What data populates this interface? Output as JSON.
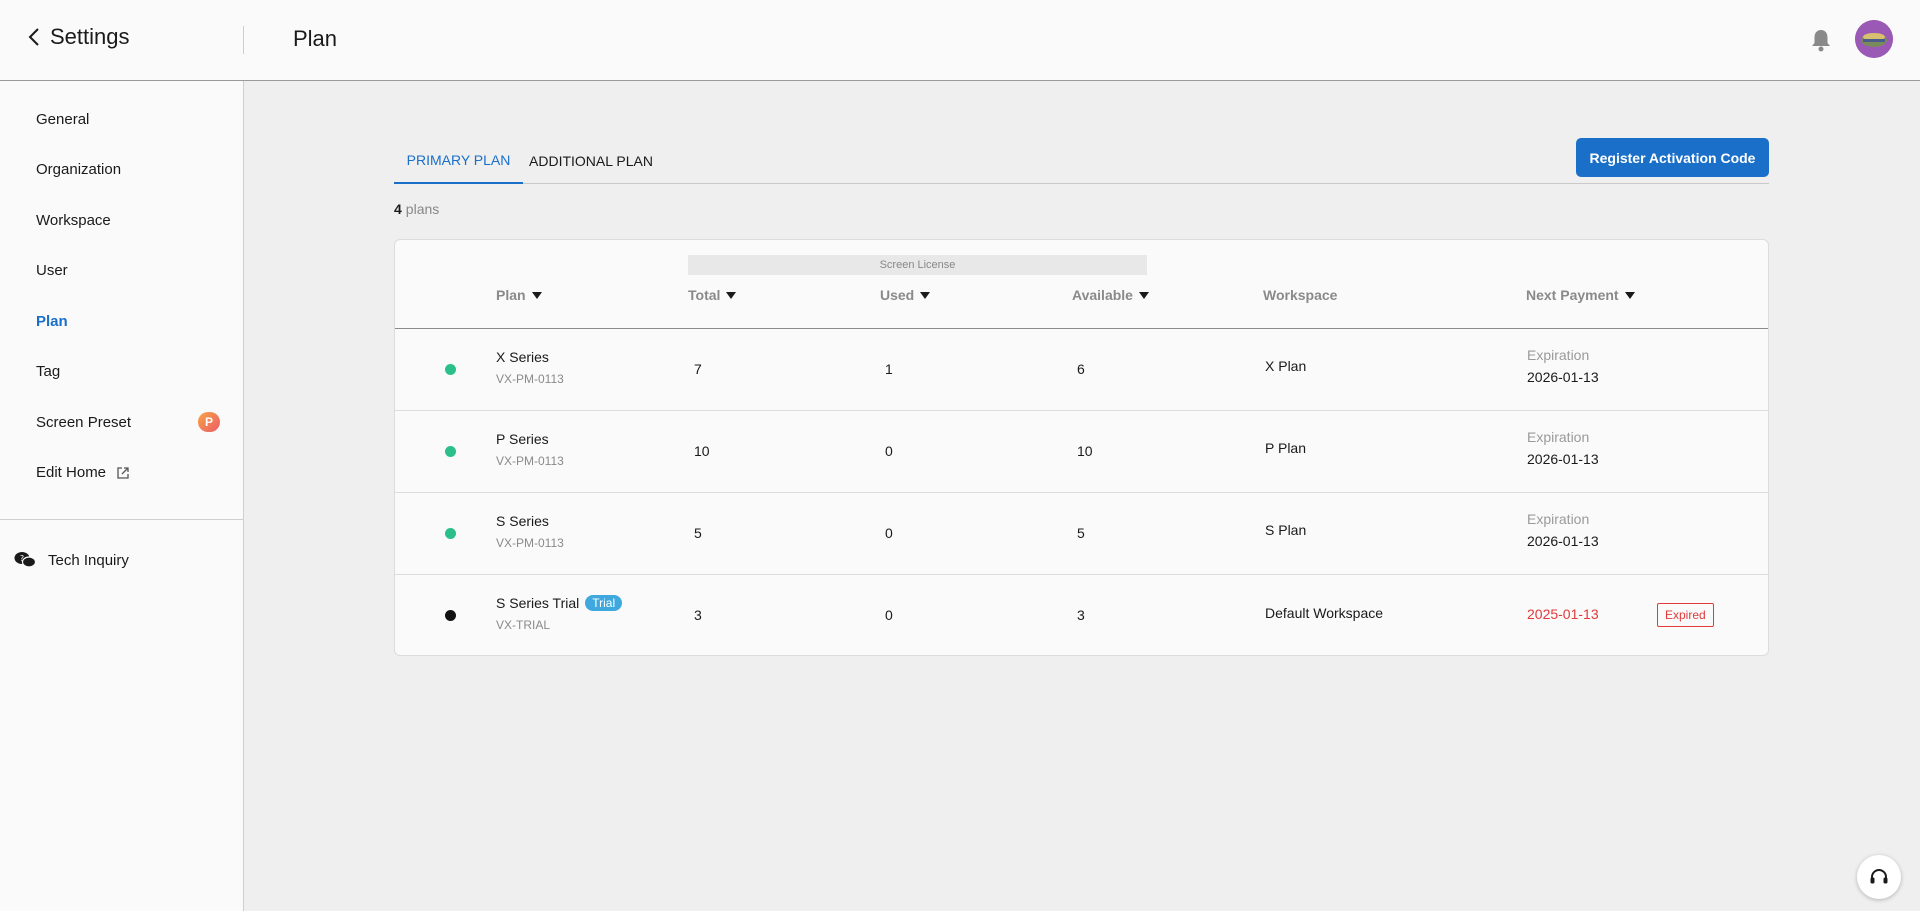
{
  "header": {
    "back_label": "Settings",
    "page_title": "Plan"
  },
  "sidebar": {
    "items": [
      {
        "label": "General"
      },
      {
        "label": "Organization"
      },
      {
        "label": "Workspace"
      },
      {
        "label": "User"
      },
      {
        "label": "Plan"
      },
      {
        "label": "Tag"
      },
      {
        "label": "Screen Preset",
        "badge": "P"
      },
      {
        "label": "Edit Home"
      }
    ],
    "tech_inquiry": "Tech Inquiry"
  },
  "tabs": {
    "primary": "PRIMARY PLAN",
    "additional": "ADDITIONAL PLAN"
  },
  "register_button": "Register Activation Code",
  "summary": {
    "count": "4",
    "unit": "plans"
  },
  "table": {
    "group_header": "Screen License",
    "columns": {
      "plan": "Plan",
      "total": "Total",
      "used": "Used",
      "available": "Available",
      "workspace": "Workspace",
      "next_payment": "Next Payment"
    },
    "rows": [
      {
        "name": "X Series",
        "code": "VX-PM-0113",
        "total": "7",
        "used": "1",
        "available": "6",
        "workspace": "X Plan",
        "exp_label": "Expiration",
        "date": "2026-01-13",
        "status_color": "#2bc08a"
      },
      {
        "name": "P Series",
        "code": "VX-PM-0113",
        "total": "10",
        "used": "0",
        "available": "10",
        "workspace": "P Plan",
        "exp_label": "Expiration",
        "date": "2026-01-13",
        "status_color": "#2bc08a"
      },
      {
        "name": "S Series",
        "code": "VX-PM-0113",
        "total": "5",
        "used": "0",
        "available": "5",
        "workspace": "S Plan",
        "exp_label": "Expiration",
        "date": "2026-01-13",
        "status_color": "#2bc08a"
      },
      {
        "name": "S Series Trial",
        "trial_badge": "Trial",
        "code": "VX-TRIAL",
        "total": "3",
        "used": "0",
        "available": "3",
        "workspace": "Default Workspace",
        "date": "2025-01-13",
        "expired_badge": "Expired",
        "status_color": "#111111"
      }
    ]
  },
  "colors": {
    "accent": "#1a6fc9",
    "active_status": "#2bc08a",
    "expired": "#e03a3a"
  }
}
